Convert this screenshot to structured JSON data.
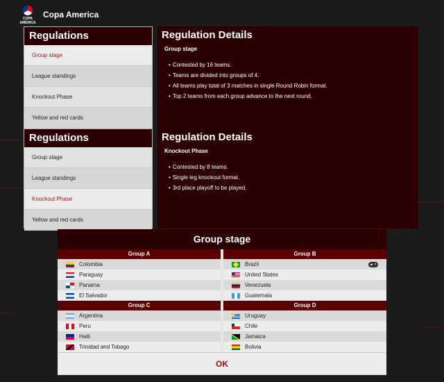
{
  "app": {
    "title": "Copa America",
    "logo_text": "COPA AMÉRICA"
  },
  "regulations_top": {
    "heading": "Regulations",
    "items": [
      {
        "label": "Group stage",
        "active": true
      },
      {
        "label": "League standings",
        "active": false
      },
      {
        "label": "Knockout Phase",
        "active": false
      },
      {
        "label": "Yellow and red cards",
        "active": false
      }
    ]
  },
  "details_top": {
    "heading": "Regulation Details",
    "subtitle": "Group stage",
    "bullets": [
      "Contested by 16 teams.",
      "Teams are divided into groups of 4.",
      "All teams play total of 3 matches in single Round Robin format.",
      "Top 2 teams from each group advance to the next round."
    ]
  },
  "regulations_bottom": {
    "heading": "Regulations",
    "items": [
      {
        "label": "Group stage",
        "active": false
      },
      {
        "label": "League standings",
        "active": false
      },
      {
        "label": "Knockout Phase",
        "active": true
      },
      {
        "label": "Yellow and red cards",
        "active": false
      }
    ]
  },
  "details_bottom": {
    "heading": "Regulation Details",
    "subtitle": "Knockout Phase",
    "bullets": [
      "Contested by 8 teams.",
      "Single leg knockout format.",
      "3rd place playoff to be played."
    ]
  },
  "group_stage": {
    "title": "Group stage",
    "groups": [
      {
        "name": "Group A",
        "teams": [
          {
            "name": "Colombia",
            "flag": "colombia"
          },
          {
            "name": "Paraguay",
            "flag": "paraguay"
          },
          {
            "name": "Panama",
            "flag": "panama"
          },
          {
            "name": "El Salvador",
            "flag": "elsalvador"
          }
        ]
      },
      {
        "name": "Group B",
        "teams": [
          {
            "name": "Brazil",
            "flag": "brazil",
            "user": true
          },
          {
            "name": "United States",
            "flag": "usa"
          },
          {
            "name": "Venezuela",
            "flag": "venezuela"
          },
          {
            "name": "Guatemala",
            "flag": "guatemala"
          }
        ]
      },
      {
        "name": "Group C",
        "teams": [
          {
            "name": "Argentina",
            "flag": "argentina"
          },
          {
            "name": "Peru",
            "flag": "peru"
          },
          {
            "name": "Haiti",
            "flag": "haiti"
          },
          {
            "name": "Trinidad and Tobago",
            "flag": "tt"
          }
        ]
      },
      {
        "name": "Group D",
        "teams": [
          {
            "name": "Uruguay",
            "flag": "uruguay"
          },
          {
            "name": "Chile",
            "flag": "chile"
          },
          {
            "name": "Jamaica",
            "flag": "jamaica"
          },
          {
            "name": "Bolivia",
            "flag": "bolivia"
          }
        ]
      }
    ],
    "ok_label": "OK"
  },
  "colors": {
    "panel_dark": "#2a0000",
    "group_header": "#5a0000",
    "accent_red": "#9a1010"
  }
}
